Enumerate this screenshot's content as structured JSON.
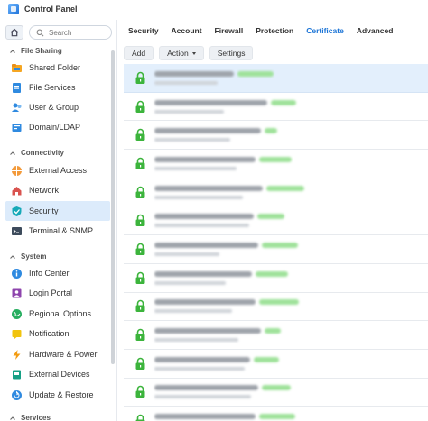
{
  "window": {
    "title": "Control Panel"
  },
  "search": {
    "placeholder": "Search"
  },
  "sidebar": {
    "sections": [
      {
        "label": "File Sharing"
      },
      {
        "label": "Connectivity"
      },
      {
        "label": "System"
      },
      {
        "label": "Services"
      }
    ],
    "items": [
      {
        "label": "Shared Folder",
        "icon": "shared-folder-icon"
      },
      {
        "label": "File Services",
        "icon": "file-services-icon"
      },
      {
        "label": "User & Group",
        "icon": "user-group-icon"
      },
      {
        "label": "Domain/LDAP",
        "icon": "domain-ldap-icon"
      },
      {
        "label": "External Access",
        "icon": "external-access-icon"
      },
      {
        "label": "Network",
        "icon": "network-icon"
      },
      {
        "label": "Security",
        "icon": "security-shield-icon",
        "active": true
      },
      {
        "label": "Terminal & SNMP",
        "icon": "terminal-icon"
      },
      {
        "label": "Info Center",
        "icon": "info-center-icon"
      },
      {
        "label": "Login Portal",
        "icon": "login-portal-icon"
      },
      {
        "label": "Regional Options",
        "icon": "regional-options-icon"
      },
      {
        "label": "Notification",
        "icon": "notification-icon"
      },
      {
        "label": "Hardware & Power",
        "icon": "hardware-power-icon"
      },
      {
        "label": "External Devices",
        "icon": "external-devices-icon"
      },
      {
        "label": "Update & Restore",
        "icon": "update-restore-icon"
      }
    ]
  },
  "tabs": [
    {
      "label": "Security"
    },
    {
      "label": "Account"
    },
    {
      "label": "Firewall"
    },
    {
      "label": "Protection"
    },
    {
      "label": "Certificate",
      "active": true
    },
    {
      "label": "Advanced"
    }
  ],
  "toolbar": {
    "add_label": "Add",
    "action_label": "Action",
    "settings_label": "Settings"
  },
  "certificates": {
    "row_count": 13,
    "selected_index": 0,
    "content_blurred": true,
    "status_icon": "lock-icon",
    "status_color": "#3cb43c"
  },
  "colors": {
    "accent": "#1b74d6",
    "selected_row": "#e3effc",
    "active_sidebar": "#dcebfb"
  }
}
